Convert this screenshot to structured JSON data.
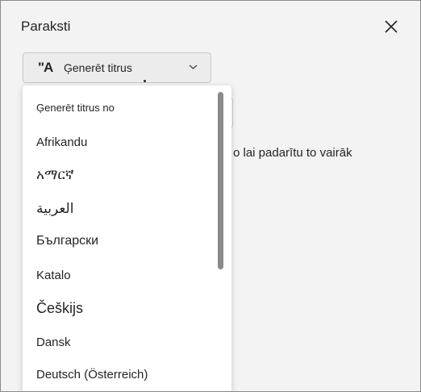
{
  "panel": {
    "title": "Paraksti"
  },
  "generate_button": {
    "icon_text": "\"A",
    "label": "Ģenerēt titrus"
  },
  "background": {
    "hint_text": "o lai padarītu to vairāk"
  },
  "dropdown": {
    "header": "Ģenerēt titrus no",
    "items": [
      {
        "label": "Afrikandu"
      },
      {
        "label": "አማርኛ"
      },
      {
        "label": "العربية"
      },
      {
        "label": "Български"
      },
      {
        "label": "Katalo"
      },
      {
        "label": "Češkijs"
      },
      {
        "label": "Dansk"
      },
      {
        "label": "Deutsch (Österreich)"
      }
    ]
  },
  "colors": {
    "panel_bg": "#f3f3f3",
    "text": "#242424",
    "scrollbar": "#8a8a8a"
  },
  "icons": {
    "close": "close-icon",
    "chevron": "chevron-down-icon",
    "captions": "captions-icon"
  }
}
